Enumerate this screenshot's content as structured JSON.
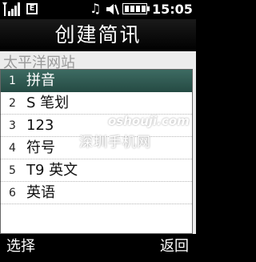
{
  "status": {
    "time": "15:05",
    "network_letter": "E",
    "icons": [
      "signal-icon",
      "edge-icon",
      "music-icon",
      "silent-icon",
      "battery-icon"
    ]
  },
  "header": {
    "title": "创建简讯"
  },
  "editor": {
    "text": "太平洋网站"
  },
  "menu": {
    "items": [
      {
        "num": "1",
        "label": "拼音",
        "selected": true
      },
      {
        "num": "2",
        "label": "S 笔划"
      },
      {
        "num": "3",
        "label": "123"
      },
      {
        "num": "4",
        "label": "符号"
      },
      {
        "num": "5",
        "label": "T9 英文"
      },
      {
        "num": "6",
        "label": "英语"
      }
    ]
  },
  "watermark": {
    "line1": "oshouji.com",
    "line2": "深圳手机网"
  },
  "softkeys": {
    "left": "选择",
    "right": "返回"
  },
  "colors": {
    "selection": "#2f5a52",
    "background": "#000000"
  }
}
